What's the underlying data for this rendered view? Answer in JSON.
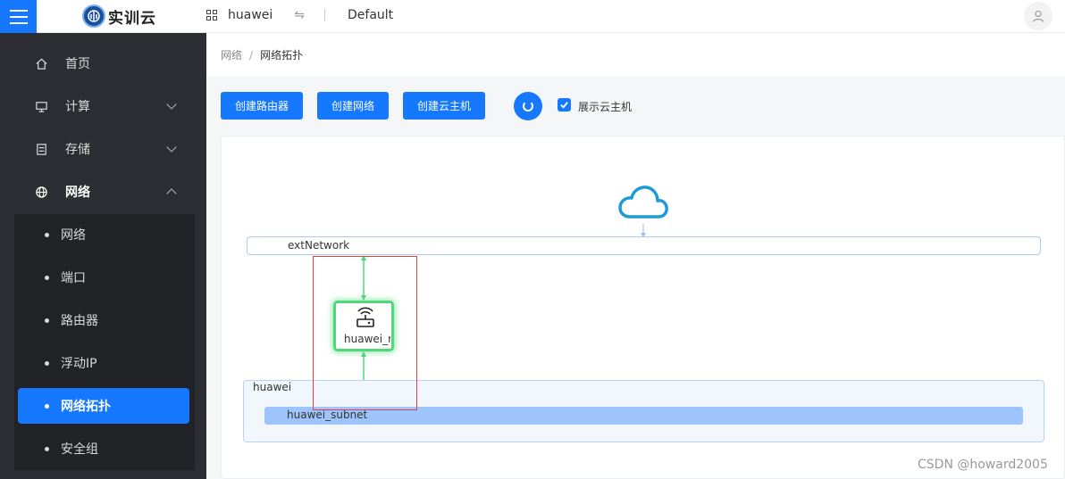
{
  "header": {
    "logo_text": "实训云",
    "project": "huawei",
    "domain": "Default"
  },
  "sidebar": {
    "items": [
      {
        "label": "首页",
        "icon": "home-icon"
      },
      {
        "label": "计算",
        "icon": "monitor-icon"
      },
      {
        "label": "存储",
        "icon": "storage-icon"
      },
      {
        "label": "网络",
        "icon": "globe-icon"
      }
    ],
    "submenu": [
      {
        "label": "网络"
      },
      {
        "label": "端口"
      },
      {
        "label": "路由器"
      },
      {
        "label": "浮动IP"
      },
      {
        "label": "网络拓扑",
        "active": true
      },
      {
        "label": "安全组"
      }
    ]
  },
  "breadcrumb": {
    "parent": "网络",
    "separator": "/",
    "current": "网络拓扑"
  },
  "toolbar": {
    "create_router": "创建路由器",
    "create_network": "创建网络",
    "create_instance": "创建云主机",
    "show_instances_label": "展示云主机",
    "show_instances_checked": true
  },
  "topology": {
    "external_network": "extNetwork",
    "router": "huawei_ro",
    "project_group": "huawei",
    "subnet": "huawei_subnet"
  },
  "colors": {
    "accent": "#1677ff",
    "sidebar_bg": "#2d2e33",
    "router_border": "#52d67c",
    "subnet_fill": "#9dc4fb",
    "cloud": "#1e9bd7"
  },
  "watermark": "CSDN @howard2005"
}
